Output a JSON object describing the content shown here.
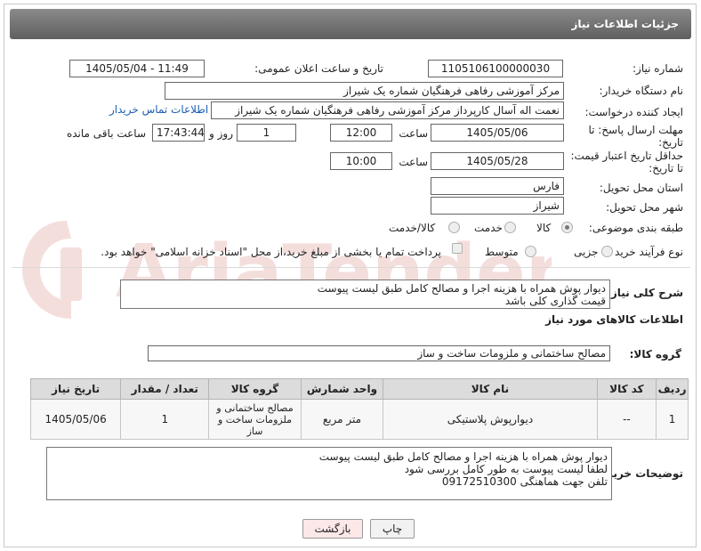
{
  "header": {
    "title": "جزئیات اطلاعات نیاز"
  },
  "form": {
    "need_number": {
      "label": "شماره نیاز:",
      "value": "1105106100000030"
    },
    "announce_datetime": {
      "label": "تاریخ و ساعت اعلان عمومی:",
      "value": "1405/05/04 - 11:49"
    },
    "buyer_org": {
      "label": "نام دستگاه خریدار:",
      "value": "مرکز آموزشی رفاهی فرهنگیان شماره یک شیراز"
    },
    "requester": {
      "label": "ایجاد کننده درخواست:",
      "value": "نعمت اله آسال کارپرداز مرکز آموزشی رفاهی فرهنگیان شماره یک شیراز",
      "contact_link": "اطلاعات تماس خریدار"
    },
    "deadline": {
      "label_line1": "مهلت ارسال پاسخ: تا",
      "label_line2": "تاریخ:",
      "date": "1405/05/06",
      "time_label": "ساعت",
      "time": "12:00",
      "days": "1",
      "days_label": "روز و",
      "remaining": "17:43:44",
      "remaining_label": "ساعت باقی مانده"
    },
    "min_validity": {
      "label_line1": "حداقل تاریخ اعتبار قیمت:",
      "label_line2": "تا تاریخ:",
      "date": "1405/05/28",
      "time_label": "ساعت",
      "time": "10:00"
    },
    "province": {
      "label": "استان محل تحویل:",
      "value": "فارس"
    },
    "city": {
      "label": "شهر محل تحویل:",
      "value": "شیراز"
    },
    "category": {
      "label": "طبقه بندی موضوعی:",
      "options": [
        "کالا",
        "خدمت",
        "کالا/خدمت"
      ],
      "selected": "کالا"
    },
    "purchase_type": {
      "label": "نوع فرآیند خرید :",
      "options": [
        "جزیی",
        "متوسط"
      ],
      "selected": "جزیی",
      "payment_note": "پرداخت تمام یا بخشی از مبلغ خرید،از محل \"اسناد خزانه اسلامی\" خواهد بود."
    }
  },
  "general_description": {
    "label": "شرح کلی نیاز:",
    "text": "دیوار پوش همراه با هزینه اجرا و مصالح کامل طبق لیست پیوست\nقیمت گذاری کلی باشد"
  },
  "goods_section": {
    "title": "اطلاعات کالاهای مورد نیاز",
    "group_label": "گروه کالا:",
    "group_value": "مصالح ساختمانی و ملزومات ساخت و ساز"
  },
  "table": {
    "headers": [
      "ردیف",
      "کد کالا",
      "نام کالا",
      "واحد شمارش",
      "گروه کالا",
      "تعداد / مقدار",
      "تاریخ نیاز"
    ],
    "rows": [
      [
        "1",
        "--",
        "دیوارپوش پلاستیکی",
        "متر مربع",
        "مصالح ساختمانی و ملزومات ساخت و ساز",
        "1",
        "1405/05/06"
      ]
    ]
  },
  "buyer_notes": {
    "label": "توضیحات خریدار:",
    "text": "دیوار پوش همراه با هزینه اجرا و مصالح کامل طبق لیست پیوست\nلطفا لیست پیوست به طور کامل بررسی شود\nتلفن جهت هماهنگی 09172510300"
  },
  "buttons": {
    "print": "چاپ",
    "back": "بازگشت"
  },
  "watermark": {
    "text": "AriaTender.net"
  },
  "colors": {
    "titlebar": "#6e6e6e",
    "link": "#1a5fb4",
    "back_button": "#fde8e8"
  }
}
